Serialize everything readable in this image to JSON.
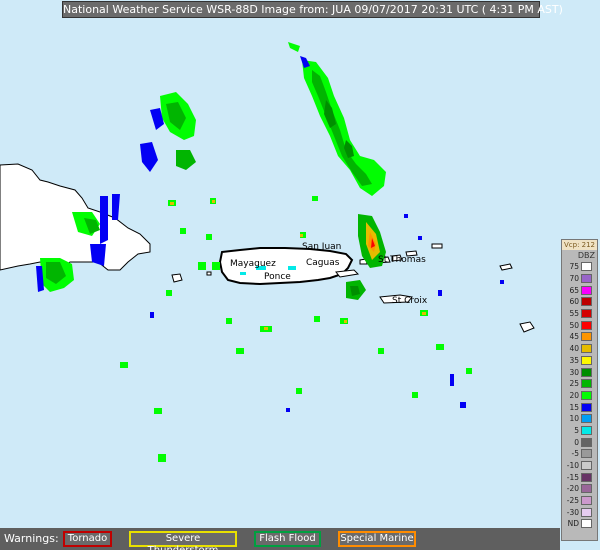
{
  "header": {
    "title": "National Weather Service WSR-88D Image from: JUA 09/07/2017 20:31 UTC ( 4:31 PM AST)"
  },
  "places": {
    "san_juan": "San Juan",
    "mayaguez": "Mayaguez",
    "caguas": "Caguas",
    "ponce": "Ponce",
    "st_thomas": "St Thomas",
    "st_croix": "St Croix"
  },
  "legend": {
    "vcp": "Vcp: 212",
    "unit": "DBZ",
    "levels": [
      {
        "label": "75",
        "color": "#ffffff"
      },
      {
        "label": "70",
        "color": "#9966c9"
      },
      {
        "label": "65",
        "color": "#f800fd"
      },
      {
        "label": "60",
        "color": "#bd0000"
      },
      {
        "label": "55",
        "color": "#d40000"
      },
      {
        "label": "50",
        "color": "#fd0000"
      },
      {
        "label": "45",
        "color": "#fd9500"
      },
      {
        "label": "40",
        "color": "#e5bc00"
      },
      {
        "label": "35",
        "color": "#fdf802"
      },
      {
        "label": "30",
        "color": "#008e00"
      },
      {
        "label": "25",
        "color": "#01b501"
      },
      {
        "label": "20",
        "color": "#02fd02"
      },
      {
        "label": "15",
        "color": "#0300f4"
      },
      {
        "label": "10",
        "color": "#019ff4"
      },
      {
        "label": "5",
        "color": "#04e9e7"
      },
      {
        "label": "0",
        "color": "#646464"
      },
      {
        "label": "-5",
        "color": "#999999"
      },
      {
        "label": "-10",
        "color": "#cccccc"
      },
      {
        "label": "-15",
        "color": "#673366"
      },
      {
        "label": "-20",
        "color": "#996699"
      },
      {
        "label": "-25",
        "color": "#cc99cc"
      },
      {
        "label": "-30",
        "color": "#e6ccf0"
      },
      {
        "label": "ND",
        "color": "#ffffff"
      }
    ]
  },
  "warnings": {
    "label": "Warnings:",
    "tornado": "Tornado",
    "tornado_color": "#c00000",
    "severe_thunderstorm": "Severe Thunderstorm",
    "severe_thunderstorm_color": "#e8e000",
    "flash_flood": "Flash Flood",
    "flash_flood_color": "#00a040",
    "special_marine": "Special Marine",
    "special_marine_color": "#ff8c00"
  }
}
